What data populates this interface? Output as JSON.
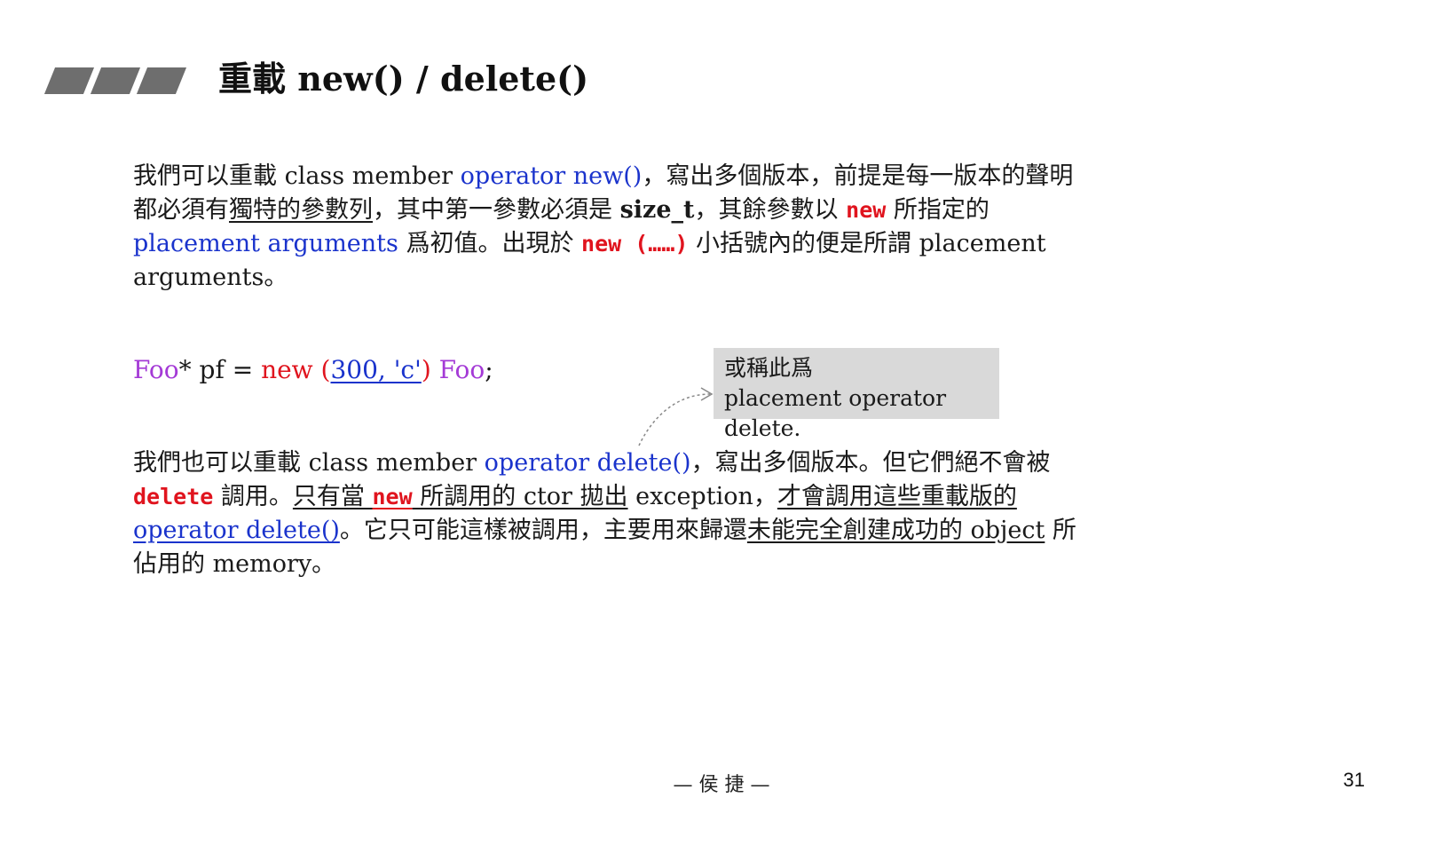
{
  "slide": {
    "title": "重載 new() / delete()",
    "para1": {
      "s1": "我們可以重載 class member ",
      "s2": "operator new()",
      "s3": "，寫出多個版本，前提是每一版本的聲明都必須有",
      "s4": "獨特的參數列",
      "s5": "，其中第一參數必須是 ",
      "s6": "size_t",
      "s7": "，其餘參數以 ",
      "s8": "new",
      "s9": " 所指定的 ",
      "s10": "placement arguments",
      "s11": " 爲初值。出現於 ",
      "s12": "new (……)",
      "s13": " 小括號內的便是所謂 placement arguments。"
    },
    "code": {
      "c1": "Foo",
      "c2": "* pf = ",
      "c3": "new",
      "c4": " (",
      "c5": "300, 'c'",
      "c6": ")",
      "c7": " Foo",
      "c8": ";"
    },
    "note": {
      "line1": "或稱此爲",
      "line2": "placement operator delete."
    },
    "para2": {
      "s1": "我們也可以重載 class member ",
      "s2": "operator delete()",
      "s3": "，寫出多個版本。但它們絕不會被 ",
      "s4": "delete",
      "s5": " 調用。",
      "s6": "只有當 ",
      "s7": "new",
      "s8": " 所調用的 ctor 拋出",
      "s9": " exception，",
      "s10": "才會調用這些重載版的 ",
      "s11": "operator delete()",
      "s12": "。它只可能這樣被調用，主要用來歸還",
      "s13": "未能完全創建成功的 object",
      "s14": " 所佔用的 memory。"
    },
    "footer": "— 侯 捷 —",
    "page_number": "31"
  }
}
